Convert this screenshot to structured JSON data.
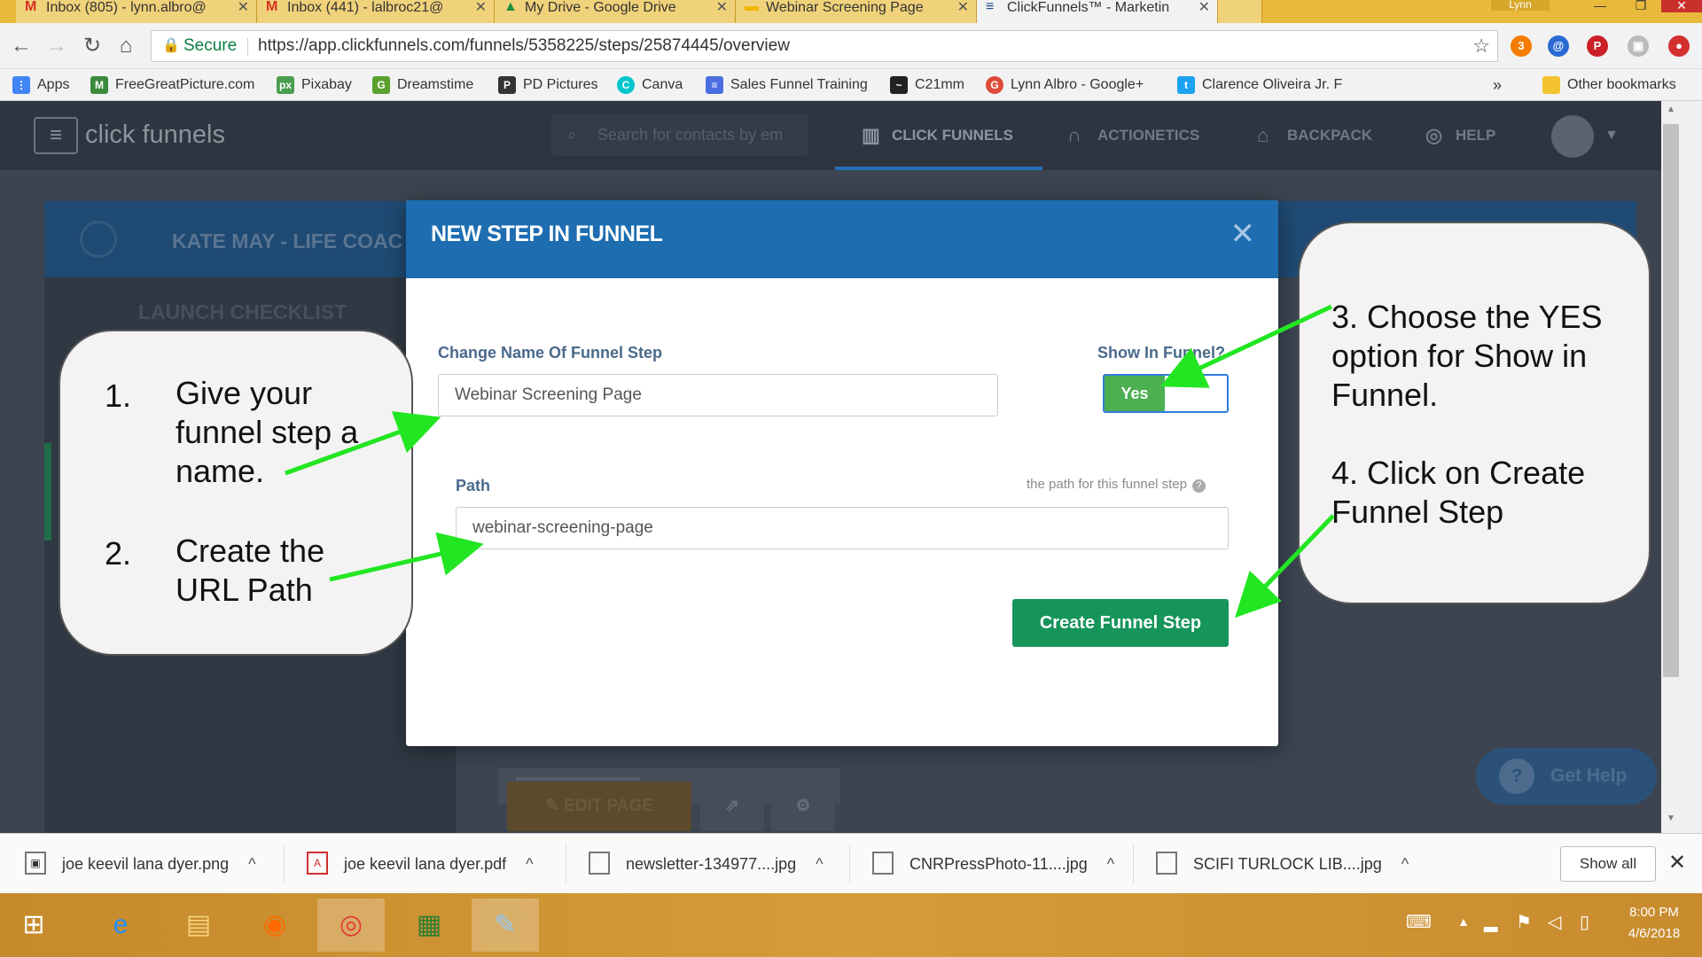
{
  "browser": {
    "tabs": [
      {
        "label": "Inbox (805) - lynn.albro@",
        "icon": "M",
        "icon_color": "#d93025"
      },
      {
        "label": "Inbox (441) - lalbroc21@",
        "icon": "M",
        "icon_color": "#d93025"
      },
      {
        "label": "My Drive - Google Drive",
        "icon": "▲",
        "icon_color": "#1e8e3e"
      },
      {
        "label": "Webinar Screening Page",
        "icon": "▬",
        "icon_color": "#f4b400"
      },
      {
        "label": "ClickFunnels™ - Marketin",
        "icon": "≡",
        "icon_color": "#1d4f86"
      }
    ],
    "user_label": "Lynn",
    "secure_label": "Secure",
    "url": "https://app.clickfunnels.com/funnels/5358225/steps/25874445/overview",
    "bookmarks": [
      {
        "label": "Apps",
        "icon_color": "#4285f4"
      },
      {
        "label": "FreeGreatPicture.com",
        "icon_color": "#3b8a3e"
      },
      {
        "label": "Pixabay",
        "icon_color": "#4b9e4f"
      },
      {
        "label": "Dreamstime",
        "icon_color": "#5aa02c"
      },
      {
        "label": "PD Pictures",
        "icon_color": "#333333"
      },
      {
        "label": "Canva",
        "icon_color": "#00c4cc"
      },
      {
        "label": "Sales Funnel Training",
        "icon_color": "#4a6ee0"
      },
      {
        "label": "C21mm",
        "icon_color": "#222222"
      },
      {
        "label": "Lynn Albro - Google+",
        "icon_color": "#dd4b39"
      },
      {
        "label": "Clarence Oliveira Jr. F",
        "icon_color": "#1da1f2"
      }
    ],
    "other_bookmarks": "Other bookmarks"
  },
  "app": {
    "logo_text": "click funnels",
    "search_placeholder": "Search for contacts by em",
    "nav": [
      {
        "label": "CLICK FUNNELS",
        "icon": "click-funnels-icon"
      },
      {
        "label": "ACTIONETICS",
        "icon": "headset-icon"
      },
      {
        "label": "BACKPACK",
        "icon": "backpack-icon"
      },
      {
        "label": "HELP",
        "icon": "lifebuoy-icon"
      }
    ],
    "funnel_name": "KATE MAY - LIFE COAC",
    "launch_checklist": "LAUNCH CHECKLIST",
    "edit_page": "EDIT PAGE",
    "get_help": "Get Help"
  },
  "modal": {
    "title": "NEW STEP IN FUNNEL",
    "name_label": "Change Name Of Funnel Step",
    "name_value": "Webinar Screening Page",
    "show_label": "Show In Funnel?",
    "toggle_value": "Yes",
    "path_label": "Path",
    "path_hint": "the path for this funnel step",
    "path_value": "webinar-screening-page",
    "create_button": "Create Funnel Step"
  },
  "callouts": {
    "step1_num": "1.",
    "step1_text": "Give your funnel step a name.",
    "step2_num": "2.",
    "step2_text": "Create the URL Path",
    "step3_text": "3. Choose the YES option for Show in Funnel.",
    "step4_text": "4. Click on Create Funnel Step"
  },
  "downloads": {
    "items": [
      {
        "label": "joe keevil lana dyer.png",
        "icon": "image-file-icon"
      },
      {
        "label": "joe keevil lana dyer.pdf",
        "icon": "pdf-file-icon"
      },
      {
        "label": "newsletter-134977....jpg",
        "icon": "file-icon"
      },
      {
        "label": "CNRPressPhoto-11....jpg",
        "icon": "file-icon"
      },
      {
        "label": "SCIFI TURLOCK LIB....jpg",
        "icon": "file-icon"
      }
    ],
    "show_all": "Show all"
  },
  "taskbar": {
    "time": "8:00 PM",
    "date": "4/6/2018"
  },
  "colors": {
    "modal_header": "#1d6db0",
    "create_button": "#16955a",
    "toggle_yes": "#4caf50",
    "arrow": "#22e622"
  }
}
